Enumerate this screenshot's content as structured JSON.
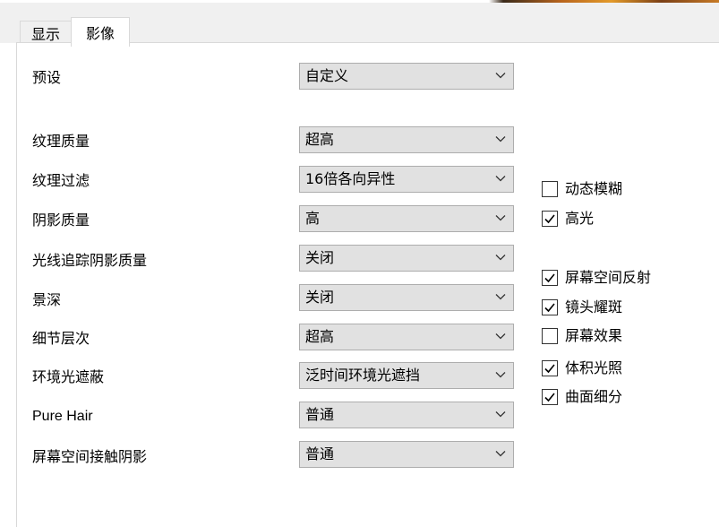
{
  "tabs": [
    {
      "label": "显示",
      "active": false
    },
    {
      "label": "影像",
      "active": true
    }
  ],
  "settings": {
    "preset": {
      "label": "预设",
      "value": "自定义"
    },
    "texture_quality": {
      "label": "纹理质量",
      "value": "超高"
    },
    "texture_filter": {
      "label": "纹理过滤",
      "value": "16倍各向异性"
    },
    "shadow_quality": {
      "label": "阴影质量",
      "value": "高"
    },
    "raytraced_shadow_quality": {
      "label": "光线追踪阴影质量",
      "value": "关闭"
    },
    "depth_of_field": {
      "label": "景深",
      "value": "关闭"
    },
    "level_of_detail": {
      "label": "细节层次",
      "value": "超高"
    },
    "ambient_occlusion": {
      "label": "环境光遮蔽",
      "value": "泛时间环境光遮挡"
    },
    "pure_hair": {
      "label": "Pure Hair",
      "value": "普通"
    },
    "contact_shadows": {
      "label": "屏幕空间接触阴影",
      "value": "普通"
    }
  },
  "checkboxes": {
    "motion_blur": {
      "label": "动态模糊",
      "checked": false
    },
    "highlights": {
      "label": "高光",
      "checked": true
    },
    "screen_space_reflections": {
      "label": "屏幕空间反射",
      "checked": true
    },
    "lens_flare": {
      "label": "镜头耀斑",
      "checked": true
    },
    "screen_effects": {
      "label": "屏幕效果",
      "checked": false
    },
    "volumetric_lighting": {
      "label": "体积光照",
      "checked": true
    },
    "tessellation": {
      "label": "曲面细分",
      "checked": true
    }
  },
  "icons": {
    "dropdown": "chevron-down-icon",
    "checkmark": "check-icon"
  }
}
